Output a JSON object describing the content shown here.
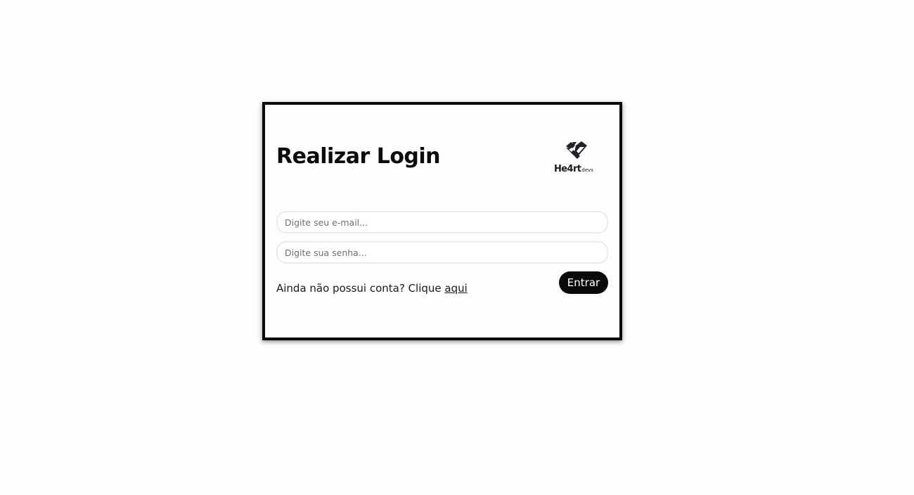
{
  "login": {
    "title": "Realizar Login",
    "email_placeholder": "Digite seu e-mail...",
    "password_placeholder": "Digite sua senha...",
    "signup_prompt": "Ainda não possui conta? Clique ",
    "signup_link": "aqui",
    "submit_label": "Entrar"
  },
  "logo": {
    "main": "He4rt",
    "sub": "devs",
    "icon": "heart-code-logo-icon"
  },
  "colors": {
    "background": "#fefcfc",
    "card_border": "#0a0a0a",
    "button_bg": "#0a0a0a",
    "button_text": "#ffffff",
    "input_border": "#ececec"
  }
}
